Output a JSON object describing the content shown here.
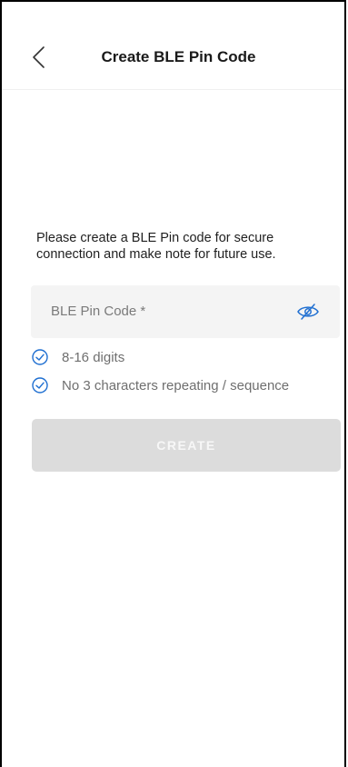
{
  "header": {
    "title": "Create BLE Pin Code",
    "back_icon": "chevron-left-icon"
  },
  "intro": {
    "text": "Please create a BLE Pin code for secure connection and make note for future use."
  },
  "pin_field": {
    "placeholder": "BLE Pin Code *",
    "value": "",
    "visibility_icon": "eye-off-icon"
  },
  "rules": [
    {
      "text": "8-16 digits",
      "icon": "check-circle-icon"
    },
    {
      "text": "No 3 characters repeating / sequence",
      "icon": "check-circle-icon"
    }
  ],
  "actions": {
    "create_label": "CREATE"
  },
  "colors": {
    "accent": "#1f6fd1",
    "field_bg": "#f4f4f4",
    "button_disabled": "#dcdcdc"
  }
}
